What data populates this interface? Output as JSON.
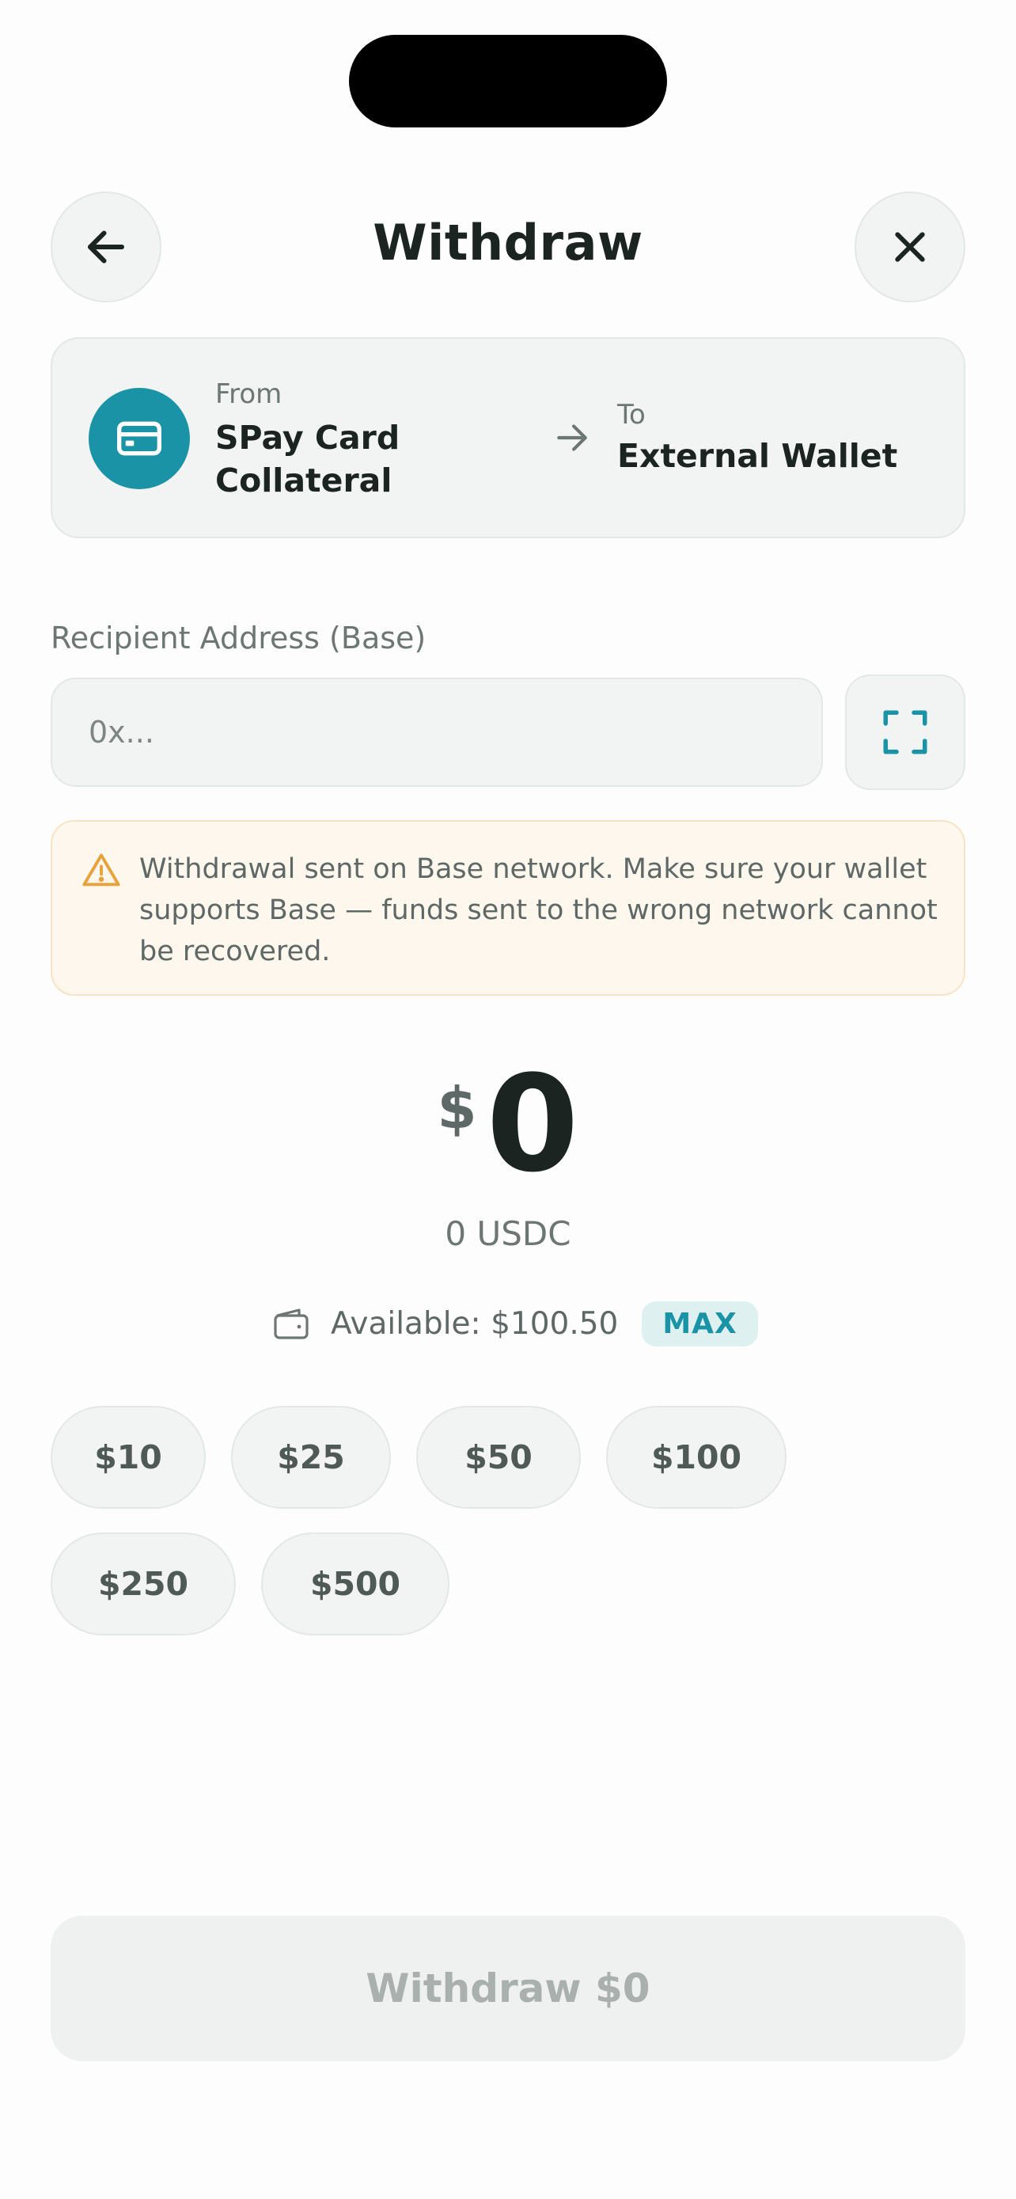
{
  "header": {
    "title": "Withdraw",
    "back_icon": "arrow-left-icon",
    "close_icon": "close-icon"
  },
  "transfer": {
    "from_label": "From",
    "from_value": "SPay Card Collateral",
    "to_label": "To",
    "to_value": "External Wallet",
    "card_icon": "credit-card-icon",
    "accent_color": "#1a93a6"
  },
  "recipient": {
    "label": "Recipient Address (Base)",
    "placeholder": "0x...",
    "value": "",
    "scan_icon": "scan-qr-icon"
  },
  "warning": {
    "icon": "warning-triangle-icon",
    "text": "Withdrawal sent on Base network. Make sure your wallet supports Base — funds sent to the wrong network cannot be recovered.",
    "color": "#e8a23c"
  },
  "amount": {
    "currency": "$",
    "value": "0",
    "token_amount": "0 USDC"
  },
  "available": {
    "icon": "wallet-icon",
    "text": "Available: $100.50",
    "max_label": "MAX"
  },
  "presets": [
    "$10",
    "$25",
    "$50",
    "$100",
    "$250",
    "$500"
  ],
  "submit": {
    "label": "Withdraw $0",
    "disabled": true
  }
}
